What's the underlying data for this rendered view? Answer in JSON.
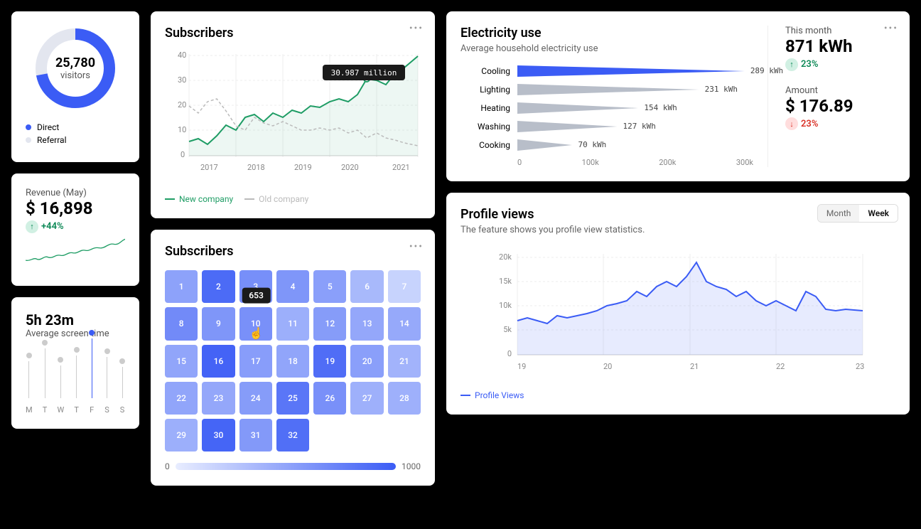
{
  "donut": {
    "value": "25,780",
    "label": "visitors",
    "direct_pct": 72,
    "legend": [
      {
        "label": "Direct",
        "color": "#3b5cf5"
      },
      {
        "label": "Referral",
        "color": "#e3e6ef"
      }
    ]
  },
  "revenue": {
    "title": "Revenue (May)",
    "value": "$ 16,898",
    "delta": "+44%"
  },
  "screen": {
    "value": "5h 23m",
    "label": "Average screen time",
    "days": [
      "M",
      "T",
      "W",
      "T",
      "F",
      "S",
      "S"
    ],
    "heights": [
      52,
      70,
      46,
      60,
      84,
      58,
      44
    ],
    "active": 4
  },
  "sub_line": {
    "title": "Subscribers",
    "tooltip": "30.987 million",
    "legend": [
      {
        "label": "New company",
        "color": "#1f9d65"
      },
      {
        "label": "Old company",
        "color": "#bbb"
      }
    ]
  },
  "sub_heat": {
    "title": "Subscribers",
    "tooltip": "653",
    "tooltip_day": 10,
    "scale_min": "0",
    "scale_max": "1000",
    "values": [
      520,
      900,
      650,
      600,
      540,
      360,
      180,
      680,
      600,
      640,
      430,
      560,
      480,
      470,
      500,
      950,
      550,
      500,
      880,
      540,
      400,
      500,
      480,
      560,
      820,
      640,
      420,
      420,
      430,
      940,
      580,
      870
    ]
  },
  "elec": {
    "title": "Electricity use",
    "sub": "Average household electricity use",
    "rows": [
      {
        "label": "Cooling",
        "v": 289,
        "hl": true
      },
      {
        "label": "Lighting",
        "v": 231
      },
      {
        "label": "Heating",
        "v": 154
      },
      {
        "label": "Washing",
        "v": 127
      },
      {
        "label": "Cooking",
        "v": 70
      }
    ],
    "xaxis": [
      "0",
      "100k",
      "200k",
      "300k"
    ],
    "month_label": "This month",
    "month_value": "871 kWh",
    "month_delta": "23%",
    "amount_label": "Amount",
    "amount_value": "$ 176.89",
    "amount_delta": "23%"
  },
  "profile": {
    "title": "Profile views",
    "sub": "The feature shows you profile view statistics.",
    "toggle": [
      "Month",
      "Week"
    ],
    "active": 1,
    "legend": "Profile Views"
  },
  "chart_data": [
    {
      "type": "line",
      "title": "Subscribers",
      "xlabel": "",
      "ylabel": "",
      "x": [
        2017,
        2018,
        2019,
        2020,
        2021
      ],
      "ylim": [
        0,
        40
      ],
      "y_ticks": [
        0,
        10,
        20,
        30,
        40
      ],
      "series": [
        {
          "name": "New company",
          "values_interpolated": [
            6,
            7,
            5,
            8,
            12,
            10,
            15,
            16,
            13,
            17,
            15,
            18,
            17,
            20,
            19,
            22,
            23,
            22,
            25,
            31,
            30,
            28,
            33,
            35,
            40
          ]
        },
        {
          "name": "Old company",
          "values_interpolated": [
            20,
            17,
            22,
            23,
            18,
            12,
            10,
            15,
            13,
            12,
            14,
            12,
            10,
            10,
            11,
            10,
            11,
            9,
            10,
            7,
            9,
            7,
            6,
            5,
            4
          ]
        }
      ],
      "annotation": {
        "x": 2020,
        "y": 30.987,
        "text": "30.987 million"
      }
    },
    {
      "type": "heatmap",
      "title": "Subscribers",
      "categories": [
        "1",
        "2",
        "3",
        "4",
        "5",
        "6",
        "7",
        "8",
        "9",
        "10",
        "11",
        "12",
        "13",
        "14",
        "15",
        "16",
        "17",
        "18",
        "19",
        "20",
        "21",
        "22",
        "23",
        "24",
        "25",
        "26",
        "27",
        "28",
        "29",
        "30",
        "31"
      ],
      "values": [
        520,
        900,
        650,
        600,
        540,
        360,
        180,
        680,
        600,
        640,
        430,
        560,
        480,
        470,
        500,
        950,
        550,
        500,
        880,
        540,
        400,
        500,
        480,
        560,
        820,
        640,
        420,
        420,
        430,
        940,
        580,
        870
      ],
      "range": [
        0,
        1000
      ]
    },
    {
      "type": "bar",
      "title": "Electricity use",
      "orientation": "horizontal",
      "categories": [
        "Cooling",
        "Lighting",
        "Heating",
        "Washing",
        "Cooking"
      ],
      "values": [
        289,
        231,
        154,
        127,
        70
      ],
      "unit": "kWh",
      "xlim": [
        0,
        300000
      ],
      "x_ticks": [
        "0",
        "100k",
        "200k",
        "300k"
      ]
    },
    {
      "type": "area",
      "title": "Profile views",
      "x": [
        19,
        20,
        21,
        22,
        23
      ],
      "ylim": [
        0,
        20000
      ],
      "y_ticks": [
        "0",
        "5k",
        "10k",
        "15k",
        "20k"
      ],
      "series": [
        {
          "name": "Profile Views",
          "values_interpolated": [
            7,
            7.5,
            7,
            6.5,
            8,
            7.5,
            8,
            8.5,
            9,
            10,
            10.5,
            11,
            13,
            12,
            14,
            15,
            14,
            16,
            19,
            15,
            14,
            13.5,
            12,
            13,
            11,
            10,
            11,
            10,
            9,
            13,
            12,
            9.5,
            9,
            9.5,
            9
          ]
        }
      ]
    }
  ]
}
